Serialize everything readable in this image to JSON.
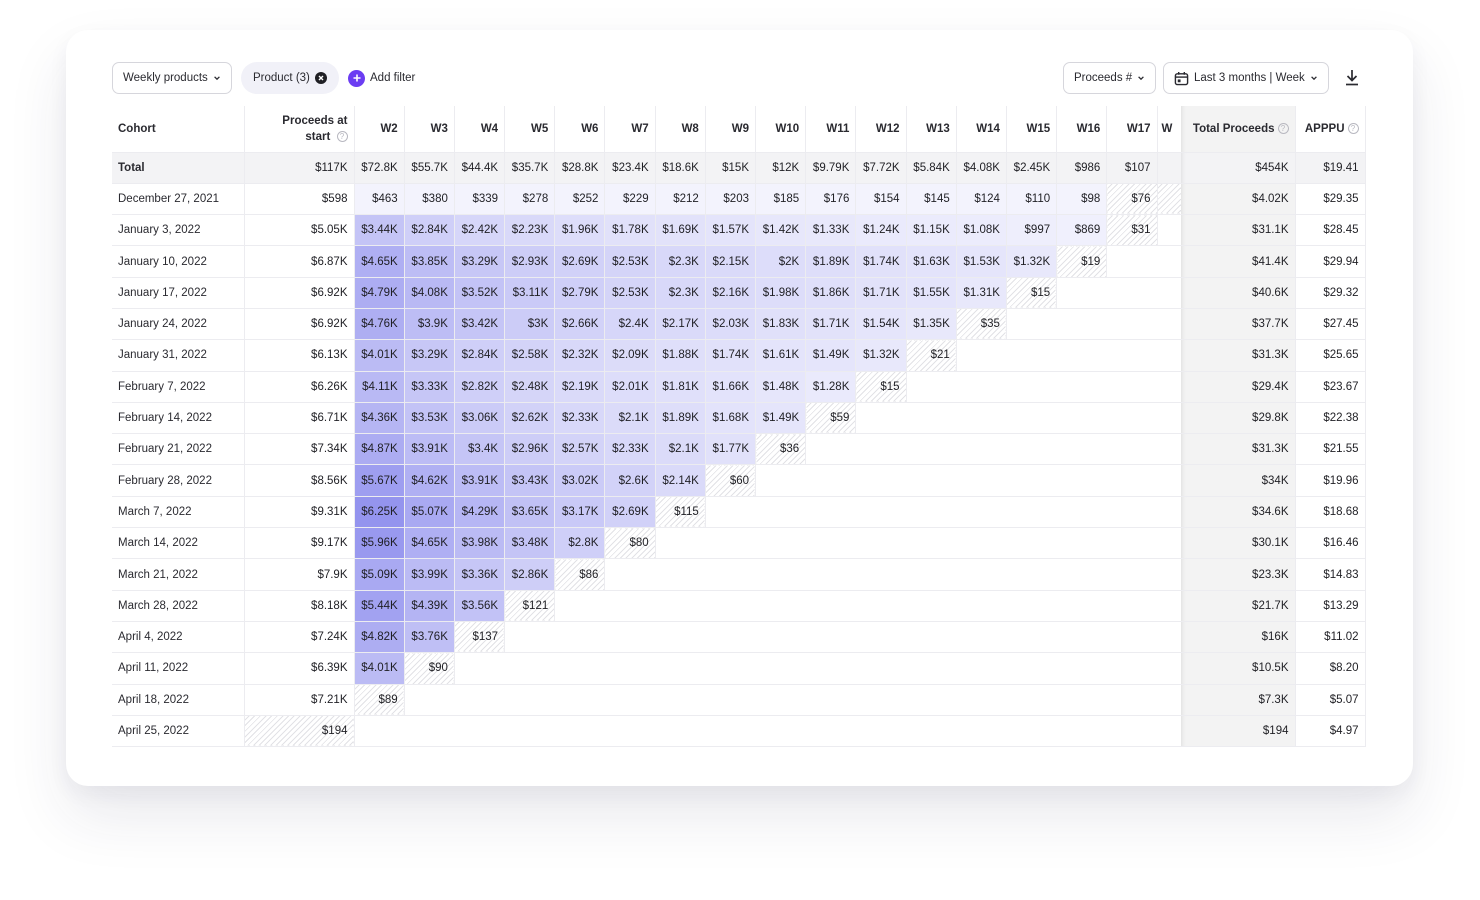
{
  "toolbar": {
    "view_selector": "Weekly products",
    "filter_chip": "Product (3)",
    "add_filter": "Add filter",
    "metric_selector": "Proceeds #",
    "date_range": "Last 3 months | Week",
    "accent_color": "#6b3df2"
  },
  "table": {
    "headers": {
      "cohort": "Cohort",
      "start_line1": "Proceeds at",
      "start_line2": "start",
      "weeks": [
        "W2",
        "W3",
        "W4",
        "W5",
        "W6",
        "W7",
        "W8",
        "W9",
        "W10",
        "W11",
        "W12",
        "W13",
        "W14",
        "W15",
        "W16",
        "W17",
        "W"
      ],
      "total_proceeds": "Total Proceeds",
      "apppu": "APPPU"
    },
    "total_row": {
      "cohort": "Total",
      "start": "$117K",
      "weeks": [
        "$72.8K",
        "$55.7K",
        "$44.4K",
        "$35.7K",
        "$28.8K",
        "$23.4K",
        "$18.6K",
        "$15K",
        "$12K",
        "$9.79K",
        "$7.72K",
        "$5.84K",
        "$4.08K",
        "$2.45K",
        "$986",
        "$107"
      ],
      "total_proceeds": "$454K",
      "apppu": "$19.41"
    },
    "rows": [
      {
        "cohort": "December 27, 2021",
        "start": "$598",
        "weeks": [
          "$463",
          "$380",
          "$339",
          "$278",
          "$252",
          "$229",
          "$212",
          "$203",
          "$185",
          "$176",
          "$154",
          "$145",
          "$124",
          "$110",
          "$98",
          "$76"
        ],
        "total_proceeds": "$4.02K",
        "apppu": "$29.35"
      },
      {
        "cohort": "January 3, 2022",
        "start": "$5.05K",
        "weeks": [
          "$3.44K",
          "$2.84K",
          "$2.42K",
          "$2.23K",
          "$1.96K",
          "$1.78K",
          "$1.69K",
          "$1.57K",
          "$1.42K",
          "$1.33K",
          "$1.24K",
          "$1.15K",
          "$1.08K",
          "$997",
          "$869",
          "$31"
        ],
        "total_proceeds": "$31.1K",
        "apppu": "$28.45"
      },
      {
        "cohort": "January 10, 2022",
        "start": "$6.87K",
        "weeks": [
          "$4.65K",
          "$3.85K",
          "$3.29K",
          "$2.93K",
          "$2.69K",
          "$2.53K",
          "$2.3K",
          "$2.15K",
          "$2K",
          "$1.89K",
          "$1.74K",
          "$1.63K",
          "$1.53K",
          "$1.32K",
          "$19"
        ],
        "total_proceeds": "$41.4K",
        "apppu": "$29.94"
      },
      {
        "cohort": "January 17, 2022",
        "start": "$6.92K",
        "weeks": [
          "$4.79K",
          "$4.08K",
          "$3.52K",
          "$3.11K",
          "$2.79K",
          "$2.53K",
          "$2.3K",
          "$2.16K",
          "$1.98K",
          "$1.86K",
          "$1.71K",
          "$1.55K",
          "$1.31K",
          "$15"
        ],
        "total_proceeds": "$40.6K",
        "apppu": "$29.32"
      },
      {
        "cohort": "January 24, 2022",
        "start": "$6.92K",
        "weeks": [
          "$4.76K",
          "$3.9K",
          "$3.42K",
          "$3K",
          "$2.66K",
          "$2.4K",
          "$2.17K",
          "$2.03K",
          "$1.83K",
          "$1.71K",
          "$1.54K",
          "$1.35K",
          "$35"
        ],
        "total_proceeds": "$37.7K",
        "apppu": "$27.45"
      },
      {
        "cohort": "January 31, 2022",
        "start": "$6.13K",
        "weeks": [
          "$4.01K",
          "$3.29K",
          "$2.84K",
          "$2.58K",
          "$2.32K",
          "$2.09K",
          "$1.88K",
          "$1.74K",
          "$1.61K",
          "$1.49K",
          "$1.32K",
          "$21"
        ],
        "total_proceeds": "$31.3K",
        "apppu": "$25.65"
      },
      {
        "cohort": "February 7, 2022",
        "start": "$6.26K",
        "weeks": [
          "$4.11K",
          "$3.33K",
          "$2.82K",
          "$2.48K",
          "$2.19K",
          "$2.01K",
          "$1.81K",
          "$1.66K",
          "$1.48K",
          "$1.28K",
          "$15"
        ],
        "total_proceeds": "$29.4K",
        "apppu": "$23.67"
      },
      {
        "cohort": "February 14, 2022",
        "start": "$6.71K",
        "weeks": [
          "$4.36K",
          "$3.53K",
          "$3.06K",
          "$2.62K",
          "$2.33K",
          "$2.1K",
          "$1.89K",
          "$1.68K",
          "$1.49K",
          "$59"
        ],
        "total_proceeds": "$29.8K",
        "apppu": "$22.38"
      },
      {
        "cohort": "February 21, 2022",
        "start": "$7.34K",
        "weeks": [
          "$4.87K",
          "$3.91K",
          "$3.4K",
          "$2.96K",
          "$2.57K",
          "$2.33K",
          "$2.1K",
          "$1.77K",
          "$36"
        ],
        "total_proceeds": "$31.3K",
        "apppu": "$21.55"
      },
      {
        "cohort": "February 28, 2022",
        "start": "$8.56K",
        "weeks": [
          "$5.67K",
          "$4.62K",
          "$3.91K",
          "$3.43K",
          "$3.02K",
          "$2.6K",
          "$2.14K",
          "$60"
        ],
        "total_proceeds": "$34K",
        "apppu": "$19.96"
      },
      {
        "cohort": "March 7, 2022",
        "start": "$9.31K",
        "weeks": [
          "$6.25K",
          "$5.07K",
          "$4.29K",
          "$3.65K",
          "$3.17K",
          "$2.69K",
          "$115"
        ],
        "total_proceeds": "$34.6K",
        "apppu": "$18.68"
      },
      {
        "cohort": "March 14, 2022",
        "start": "$9.17K",
        "weeks": [
          "$5.96K",
          "$4.65K",
          "$3.98K",
          "$3.48K",
          "$2.8K",
          "$80"
        ],
        "total_proceeds": "$30.1K",
        "apppu": "$16.46"
      },
      {
        "cohort": "March 21, 2022",
        "start": "$7.9K",
        "weeks": [
          "$5.09K",
          "$3.99K",
          "$3.36K",
          "$2.86K",
          "$86"
        ],
        "total_proceeds": "$23.3K",
        "apppu": "$14.83"
      },
      {
        "cohort": "March 28, 2022",
        "start": "$8.18K",
        "weeks": [
          "$5.44K",
          "$4.39K",
          "$3.56K",
          "$121"
        ],
        "total_proceeds": "$21.7K",
        "apppu": "$13.29"
      },
      {
        "cohort": "April 4, 2022",
        "start": "$7.24K",
        "weeks": [
          "$4.82K",
          "$3.76K",
          "$137"
        ],
        "total_proceeds": "$16K",
        "apppu": "$11.02"
      },
      {
        "cohort": "April 11, 2022",
        "start": "$6.39K",
        "weeks": [
          "$4.01K",
          "$90"
        ],
        "total_proceeds": "$10.5K",
        "apppu": "$8.20"
      },
      {
        "cohort": "April 18, 2022",
        "start": "$7.21K",
        "weeks": [
          "$89"
        ],
        "total_proceeds": "$7.3K",
        "apppu": "$5.07"
      },
      {
        "cohort": "April 25, 2022",
        "start": "$194",
        "weeks": [],
        "total_proceeds": "$194",
        "apppu": "$4.97",
        "start_partial": true
      }
    ],
    "heat_color": "#6b6be8",
    "heat_max": 6250
  }
}
